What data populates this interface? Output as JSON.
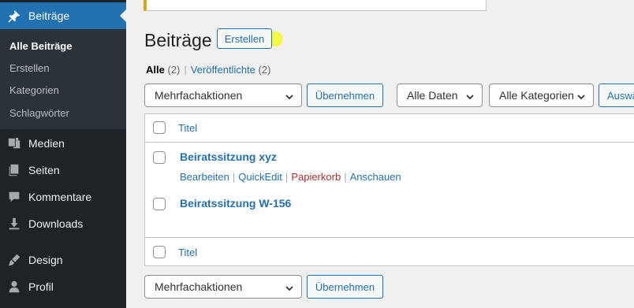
{
  "sidebar": {
    "current": {
      "label": "Beiträge",
      "icon": "pin-icon"
    },
    "submenu": [
      "Alle Beiträge",
      "Erstellen",
      "Kategorien",
      "Schlagwörter"
    ],
    "items": [
      {
        "label": "Medien",
        "icon": "media-icon"
      },
      {
        "label": "Seiten",
        "icon": "pages-icon"
      },
      {
        "label": "Kommentare",
        "icon": "comment-icon"
      },
      {
        "label": "Downloads",
        "icon": "download-icon"
      },
      {
        "label": "Design",
        "icon": "brush-icon"
      },
      {
        "label": "Profil",
        "icon": "user-icon"
      }
    ]
  },
  "header": {
    "title": "Beiträge",
    "add_label": "Erstellen"
  },
  "views": {
    "all_label": "Alle",
    "all_count": "(2)",
    "separator": "|",
    "published_label": "Veröffentlichte",
    "published_count": "(2)"
  },
  "filters": {
    "bulk_action": "Mehrfachaktionen",
    "apply_label": "Übernehmen",
    "dates": "Alle Daten",
    "categories": "Alle Kategorien",
    "filter_label": "Auswä"
  },
  "table": {
    "column_title": "Titel",
    "rows": [
      {
        "title": "Beiratssitzung xyz",
        "actions": [
          "Bearbeiten",
          "QuickEdit",
          "Papierkorb",
          "Anschauen"
        ]
      },
      {
        "title": "Beiratssitzung W-156"
      }
    ]
  },
  "colors": {
    "sidebar_bg": "#1d2327",
    "accent": "#2271b1",
    "trash": "#b32d2e",
    "highlight": "#f5f82a"
  }
}
